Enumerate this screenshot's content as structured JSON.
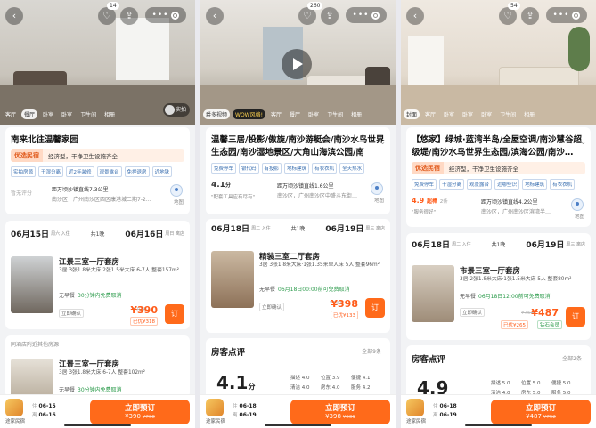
{
  "panels": [
    {
      "badge_count": "14",
      "categories": [
        "客厅",
        "餐厅",
        "卧室",
        "卧室",
        "卫生间",
        "相册"
      ],
      "active_category": 1,
      "vr_label": "实拍",
      "title": "南来北往温馨家园",
      "banner_tag": "优选民宿",
      "banner_text": "经济型，干净卫生设施齐全",
      "tags": [
        "实拍房源",
        "干湿分离",
        "近2年装修",
        "观景露台",
        "免押退房",
        "近地铁"
      ],
      "score_label": "暂无评分",
      "addr_line1": "距万顷沙镇直线7.3公里",
      "addr_line2": "南沙区，广州南沙区西区康港城二期7-2…",
      "map_label": "地图",
      "checkin_date": "06月15日",
      "checkin_sub": "周六 入住",
      "nights": "共1晚",
      "checkout_date": "06月16日",
      "checkout_sub": "周日 离店",
      "room": {
        "name": "江景三室一厅套房",
        "spec": "3居 3张1.8米大床·2张1.5米大床 6-7人 整套157m²",
        "breakfast": "无早餐",
        "cancel": "30分钟内免费取消",
        "confirm": "立即确认",
        "orig_price": "¥708",
        "price": "¥390",
        "discount": "已优¥318",
        "button": "订"
      },
      "nearby_label": "同酒店附近其他房源",
      "room2": {
        "name": "江景三室一厅套房",
        "spec": "3居 3张1.8米大床 6-7人 整套102m²",
        "breakfast": "无早餐",
        "cancel": "30分钟内免费取消"
      },
      "logo_label": "途家民宿",
      "bottom_in_label": "住",
      "bottom_in": "06-15",
      "bottom_out_label": "离",
      "bottom_out": "06-16",
      "book_label": "立即预订",
      "book_price": "¥390",
      "book_orig": "¥708"
    },
    {
      "badge_count": "260",
      "categories": [
        "爵多视频",
        "WOW风格!",
        "客厅",
        "餐厅",
        "卧室",
        "卫生间",
        "相册"
      ],
      "active_category": 0,
      "title": "温馨三居/投影/傲旋/南沙游艇会/南沙水鸟世界生态园/南沙湿地景区/大角山海滨公园/南",
      "tags": [
        "免费停车",
        "银代码",
        "有投影",
        "地标建筑",
        "有衣衣机",
        "全天热水"
      ],
      "score": "4.1",
      "score_unit": "分",
      "review_snippet": "\"配套工具应有尽有\"",
      "addr_line1": "距万顷沙镇直线1.6公里",
      "addr_line2": "南沙区，广州南沙区中盛斗东街…",
      "map_label": "地图",
      "checkin_date": "06月18日",
      "checkin_sub": "周二 入住",
      "nights": "共1晚",
      "checkout_date": "06月19日",
      "checkout_sub": "周三 离店",
      "room": {
        "name": "精装三室二厅套房",
        "spec": "3居 3张1.8米大床·1张1.35米单人床 5人 整套96m²",
        "breakfast": "无早餐",
        "cancel": "06月18日00:00前可免费取消",
        "confirm": "立即确认",
        "orig_price": "¥531",
        "price": "¥398",
        "discount": "已优¥133",
        "button": "订"
      },
      "reviews_title": "房客点评",
      "see_all": "全部9条",
      "big_score": "4.1",
      "big_score_unit": "分",
      "sub_scores": [
        "描述 4.0",
        "位置 3.9",
        "便捷 4.1",
        "清洁 4.0",
        "房东 4.0",
        "服务 4.2"
      ],
      "logo_label": "途家民宿",
      "bottom_in_label": "住",
      "bottom_in": "06-18",
      "bottom_out_label": "离",
      "bottom_out": "06-19",
      "book_label": "立即预订",
      "book_price": "¥398",
      "book_orig": "¥531"
    },
    {
      "badge_count": "54",
      "categories": [
        "封面",
        "客厅",
        "卧室",
        "卧室",
        "卧室",
        "卫生间",
        "相册"
      ],
      "active_category": 0,
      "title": "【悠家】绿城·蓝湾半岛/全屋空调/南沙慧谷超级堤/南沙水鸟世界生态园/滨海公园/南沙…",
      "banner_tag": "优选民宿",
      "banner_text": "经济型，干净卫生设施齐全",
      "tags": [
        "免费停车",
        "干湿分离",
        "观景露台",
        "近哪些识",
        "地标建筑",
        "有衣衣机"
      ],
      "score": "4.9",
      "score_label": "超棒",
      "review_count": "2条",
      "review_snippet": "\"服务很好\"",
      "addr_line1": "距万顷沙镇直线4.2公里",
      "addr_line2": "南沙区，广州南沙区滨湾半…",
      "map_label": "地图",
      "checkin_date": "06月18日",
      "checkin_sub": "周二 入住",
      "nights": "共1晚",
      "checkout_date": "06月19日",
      "checkout_sub": "周三 离店",
      "room": {
        "name": "市景三室一厅套房",
        "spec": "3居 2张1.8米大床·1张1.5米大床 5人 整套80m²",
        "breakfast": "无早餐",
        "cancel": "06月18日12:00前可免费取消",
        "confirm": "立即确认",
        "orig_price": "¥752",
        "price": "¥487",
        "discount": "已优¥265",
        "extra": "钻石会员",
        "button": "订"
      },
      "reviews_title": "房客点评",
      "see_all": "全部2条",
      "big_score": "4.9",
      "sub_scores": [
        "描述 5.0",
        "位置 5.0",
        "便捷 5.0",
        "清洁 4.0",
        "房东 5.0",
        "服务 5.0"
      ],
      "logo_label": "途家民宿",
      "bottom_in_label": "住",
      "bottom_in": "06-18",
      "bottom_out_label": "离",
      "bottom_out": "06-19",
      "book_label": "立即预订",
      "book_price": "¥487",
      "book_orig": "¥752"
    }
  ],
  "icons": {
    "back": "back-arrow-icon",
    "share": "share-icon",
    "more": "more-dots-icon",
    "close": "close-target-icon",
    "play": "play-icon",
    "map": "map-pin-icon"
  },
  "colors": {
    "accent": "#ff6a1a",
    "price": "#ff5c1a",
    "tag_text": "#3a6fb0",
    "banner_bg": "#fff0e6"
  }
}
